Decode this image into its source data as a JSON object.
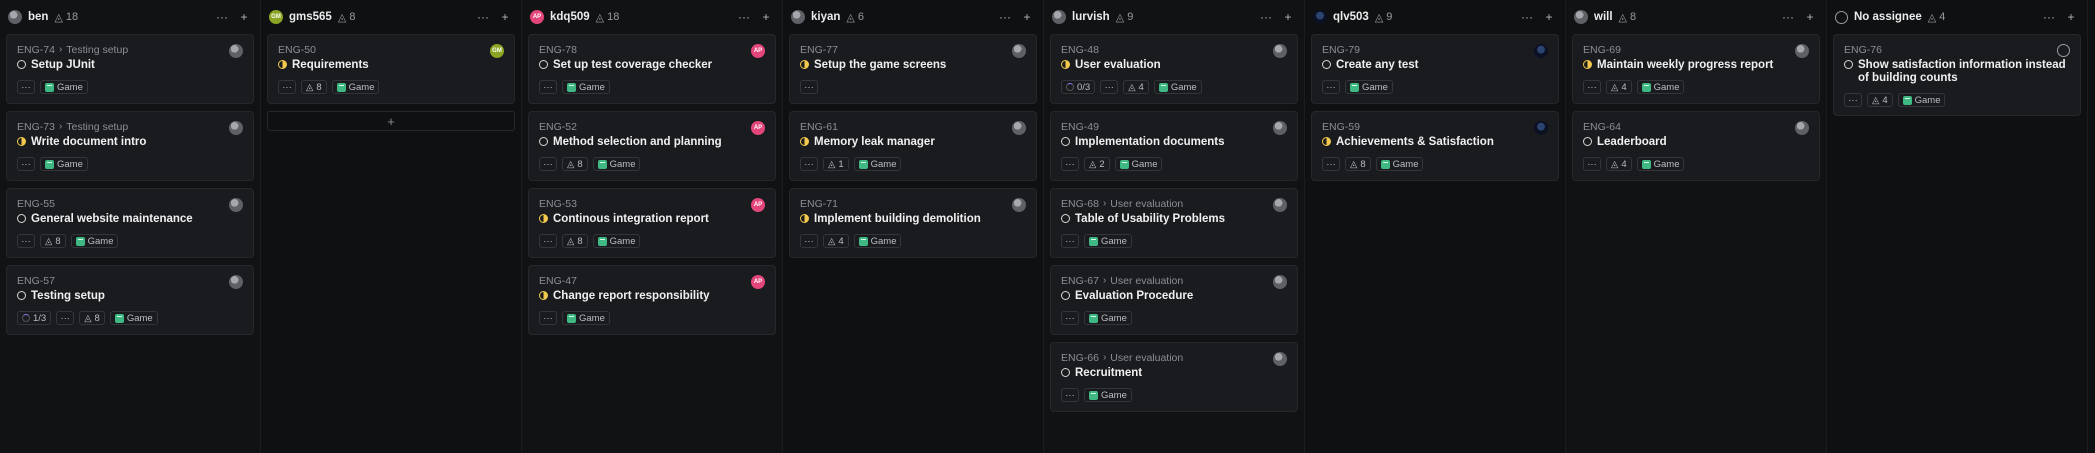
{
  "columns": [
    {
      "name": "ben",
      "count": "18",
      "avatar": "photo",
      "cards": [
        {
          "id": "ENG-74",
          "parent": "Testing setup",
          "title": "Setup JUnit",
          "status": "todo",
          "estimate": null,
          "sub": null,
          "label": "Game"
        },
        {
          "id": "ENG-73",
          "parent": "Testing setup",
          "title": "Write document intro",
          "status": "progress",
          "estimate": null,
          "sub": null,
          "label": "Game"
        },
        {
          "id": "ENG-55",
          "parent": null,
          "title": "General website maintenance",
          "status": "todo",
          "estimate": "8",
          "sub": null,
          "label": "Game"
        },
        {
          "id": "ENG-57",
          "parent": null,
          "title": "Testing setup",
          "status": "todo",
          "estimate": "8",
          "sub": "1/3",
          "label": "Game"
        }
      ]
    },
    {
      "name": "gms565",
      "count": "8",
      "avatar": "green",
      "initials": "GM",
      "cards": [
        {
          "id": "ENG-50",
          "parent": null,
          "title": "Requirements",
          "status": "progress",
          "estimate": "8",
          "sub": null,
          "label": "Game"
        }
      ],
      "add": "+"
    },
    {
      "name": "kdq509",
      "count": "18",
      "avatar": "pink",
      "initials": "AP",
      "cards": [
        {
          "id": "ENG-78",
          "parent": null,
          "title": "Set up test coverage checker",
          "status": "todo",
          "estimate": null,
          "sub": null,
          "label": "Game"
        },
        {
          "id": "ENG-52",
          "parent": null,
          "title": "Method selection and planning",
          "status": "todo",
          "estimate": "8",
          "sub": null,
          "label": "Game"
        },
        {
          "id": "ENG-53",
          "parent": null,
          "title": "Continous integration report",
          "status": "progress",
          "estimate": "8",
          "sub": null,
          "label": "Game"
        },
        {
          "id": "ENG-47",
          "parent": null,
          "title": "Change report responsibility",
          "status": "progress",
          "estimate": null,
          "sub": null,
          "label": "Game"
        }
      ]
    },
    {
      "name": "kiyan",
      "count": "6",
      "avatar": "photo",
      "cards": [
        {
          "id": "ENG-77",
          "parent": null,
          "title": "Setup the game screens",
          "status": "progress",
          "estimate": null,
          "sub": null,
          "label": null
        },
        {
          "id": "ENG-61",
          "parent": null,
          "title": "Memory leak manager",
          "status": "progress",
          "estimate": "1",
          "sub": null,
          "label": "Game"
        },
        {
          "id": "ENG-71",
          "parent": null,
          "title": "Implement building demolition",
          "status": "progress",
          "estimate": "4",
          "sub": null,
          "label": "Game"
        }
      ]
    },
    {
      "name": "lurvish",
      "count": "9",
      "avatar": "photo",
      "cards": [
        {
          "id": "ENG-48",
          "parent": null,
          "title": "User evaluation",
          "status": "progress",
          "estimate": "4",
          "sub": "0/3",
          "label": "Game"
        },
        {
          "id": "ENG-49",
          "parent": null,
          "title": "Implementation documents",
          "status": "todo",
          "estimate": "2",
          "sub": null,
          "label": "Game"
        },
        {
          "id": "ENG-68",
          "parent": "User evaluation",
          "title": "Table of Usability Problems",
          "status": "todo",
          "estimate": null,
          "sub": null,
          "label": "Game"
        },
        {
          "id": "ENG-67",
          "parent": "User evaluation",
          "title": "Evaluation Procedure",
          "status": "todo",
          "estimate": null,
          "sub": null,
          "label": "Game"
        },
        {
          "id": "ENG-66",
          "parent": "User evaluation",
          "title": "Recruitment",
          "status": "todo",
          "estimate": null,
          "sub": null,
          "label": "Game"
        }
      ]
    },
    {
      "name": "qlv503",
      "count": "9",
      "avatar": "dark",
      "cards": [
        {
          "id": "ENG-79",
          "parent": null,
          "title": "Create any test",
          "status": "todo",
          "estimate": null,
          "sub": null,
          "label": "Game"
        },
        {
          "id": "ENG-59",
          "parent": null,
          "title": "Achievements & Satisfaction",
          "status": "progress",
          "estimate": "8",
          "sub": null,
          "label": "Game"
        }
      ]
    },
    {
      "name": "will",
      "count": "8",
      "avatar": "photo",
      "cards": [
        {
          "id": "ENG-69",
          "parent": null,
          "title": "Maintain weekly progress report",
          "status": "progress",
          "estimate": "4",
          "sub": null,
          "label": "Game"
        },
        {
          "id": "ENG-64",
          "parent": null,
          "title": "Leaderboard",
          "status": "todo",
          "estimate": "4",
          "sub": null,
          "label": "Game"
        }
      ]
    },
    {
      "name": "No assignee",
      "count": "4",
      "avatar": "none",
      "cards": [
        {
          "id": "ENG-76",
          "parent": null,
          "title": "Show satisfaction information instead of building counts",
          "status": "todo",
          "estimate": "4",
          "sub": null,
          "label": "Game"
        }
      ]
    }
  ],
  "header_icons": {
    "more": "···",
    "add": "+",
    "estimate": "◬",
    "dots": "···"
  }
}
